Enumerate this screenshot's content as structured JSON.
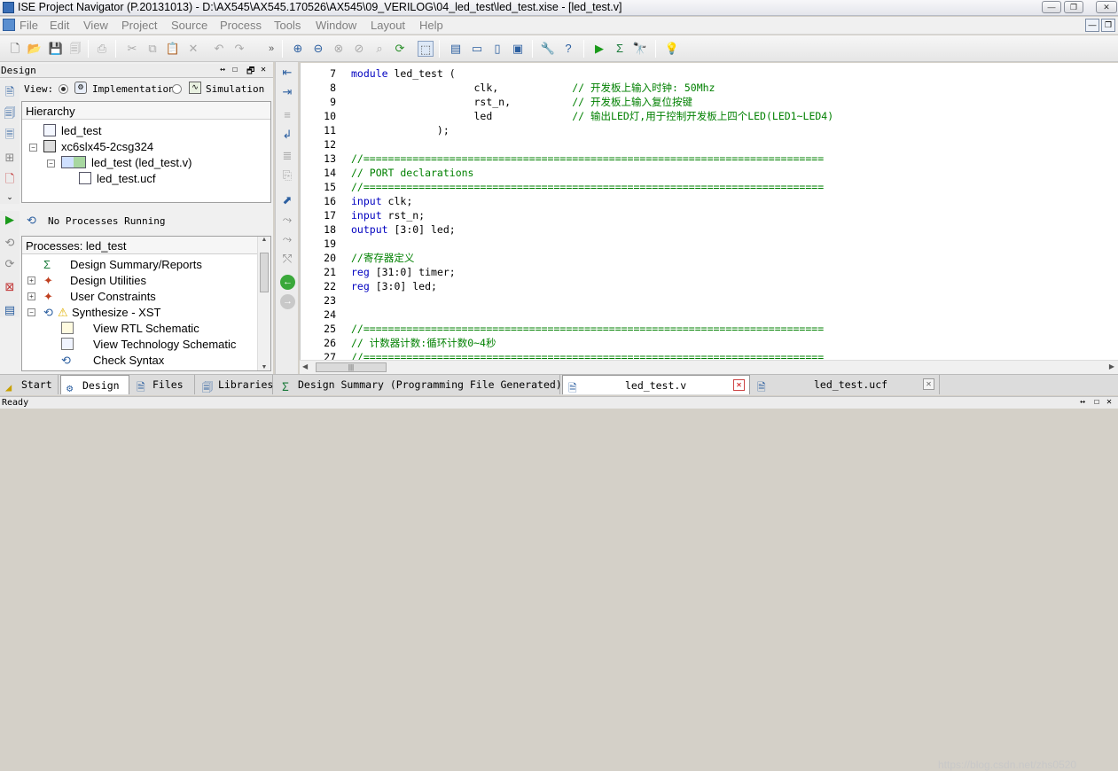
{
  "window": {
    "title": "ISE Project Navigator (P.20131013) - D:\\AX545\\AX545.170526\\AX545\\09_VERILOG\\04_led_test\\led_test.xise - [led_test.v]",
    "controls": [
      "minimize",
      "restore",
      "close"
    ]
  },
  "menu": {
    "items": [
      "File",
      "Edit",
      "View",
      "Project",
      "Source",
      "Process",
      "Tools",
      "Window",
      "Layout",
      "Help"
    ]
  },
  "toolbar": {
    "icons": [
      "new-icon",
      "open-icon",
      "save-icon",
      "save-all-icon",
      "print-icon",
      "cut-icon",
      "copy-icon",
      "paste-icon",
      "delete-icon",
      "undo-icon",
      "redo-icon",
      "more-icon",
      "zoom-in-icon",
      "zoom-out-icon",
      "zoom-fit-icon",
      "zoom-box-icon",
      "find-icon",
      "refresh-icon",
      "select-icon",
      "cascade-icon",
      "tile-h-icon",
      "tile-v-icon",
      "float-icon",
      "properties-icon",
      "help-icon",
      "run-icon",
      "sum-icon",
      "probe-icon",
      "tip-icon"
    ]
  },
  "design_panel": {
    "title": "Design",
    "view_label": "View:",
    "view_options": [
      "Implementation",
      "Simulation"
    ],
    "view_selected": "Implementation",
    "hierarchy": {
      "header": "Hierarchy",
      "items": [
        {
          "label": "led_test",
          "icon": "project-icon"
        },
        {
          "label": "xc6slx45-2csg324",
          "icon": "chip-icon"
        },
        {
          "label": "led_test (led_test.v)",
          "icon": "verilog-module-icon"
        },
        {
          "label": "led_test.ucf",
          "icon": "constraints-file-icon"
        }
      ]
    },
    "process_status": "No Processes Running",
    "processes": {
      "header": "Processes: led_test",
      "items": [
        {
          "label": "Design Summary/Reports",
          "icon": "sigma-icon"
        },
        {
          "label": "Design Utilities",
          "icon": "utilities-icon"
        },
        {
          "label": "User Constraints",
          "icon": "constraints-icon"
        },
        {
          "label": "Synthesize - XST",
          "icon": "warning-icon"
        },
        {
          "label": "View RTL Schematic",
          "icon": "schematic-icon"
        },
        {
          "label": "View Technology Schematic",
          "icon": "schematic-icon"
        },
        {
          "label": "Check Syntax",
          "icon": "check-syntax-icon"
        }
      ]
    }
  },
  "bottom_tabs": {
    "left": [
      "Start",
      "Design",
      "Files",
      "Libraries"
    ],
    "left_active": "Design",
    "documents": [
      {
        "label": "Design Summary (Programming File Generated)",
        "active": false
      },
      {
        "label": "led_test.v",
        "active": true
      },
      {
        "label": "led_test.ucf",
        "active": false
      }
    ]
  },
  "editor": {
    "lines": [
      {
        "n": "7",
        "parts": [
          [
            "kw",
            "module"
          ],
          [
            "",
            " led_test ("
          ]
        ]
      },
      {
        "n": "8",
        "parts": [
          [
            "",
            "                    clk,            "
          ],
          [
            "cm",
            "// 开发板上输入时钟: 50Mhz"
          ]
        ]
      },
      {
        "n": "9",
        "parts": [
          [
            "",
            "                    rst_n,          "
          ],
          [
            "cm",
            "// 开发板上输入复位按键"
          ]
        ]
      },
      {
        "n": "10",
        "parts": [
          [
            "",
            "                    led             "
          ],
          [
            "cm",
            "// 输出LED灯,用于控制开发板上四个LED(LED1~LED4)"
          ]
        ]
      },
      {
        "n": "11",
        "parts": [
          [
            "",
            "              );"
          ]
        ]
      },
      {
        "n": "12",
        "parts": [
          [
            "",
            ""
          ]
        ]
      },
      {
        "n": "13",
        "parts": [
          [
            "cm",
            "//==========================================================================="
          ]
        ]
      },
      {
        "n": "14",
        "parts": [
          [
            "cm",
            "// PORT declarations"
          ]
        ]
      },
      {
        "n": "15",
        "parts": [
          [
            "cm",
            "//==========================================================================="
          ]
        ]
      },
      {
        "n": "16",
        "parts": [
          [
            "kw",
            "input"
          ],
          [
            "",
            " clk;"
          ]
        ]
      },
      {
        "n": "17",
        "parts": [
          [
            "kw",
            "input"
          ],
          [
            "",
            " rst_n;"
          ]
        ]
      },
      {
        "n": "18",
        "parts": [
          [
            "kw",
            "output"
          ],
          [
            "",
            " [3:0] led;"
          ]
        ]
      },
      {
        "n": "19",
        "parts": [
          [
            "",
            ""
          ]
        ]
      },
      {
        "n": "20",
        "parts": [
          [
            "cm",
            "//寄存器定义"
          ]
        ]
      },
      {
        "n": "21",
        "parts": [
          [
            "kw",
            "reg"
          ],
          [
            "",
            " [31:0] timer;"
          ]
        ]
      },
      {
        "n": "22",
        "parts": [
          [
            "kw",
            "reg"
          ],
          [
            "",
            " [3:0] led;"
          ]
        ]
      },
      {
        "n": "23",
        "parts": [
          [
            "",
            ""
          ]
        ]
      },
      {
        "n": "24",
        "parts": [
          [
            "",
            ""
          ]
        ]
      },
      {
        "n": "25",
        "parts": [
          [
            "cm",
            "//==========================================================================="
          ]
        ]
      },
      {
        "n": "26",
        "parts": [
          [
            "cm",
            "// 计数器计数:循环计数0~4秒"
          ]
        ]
      },
      {
        "n": "27",
        "parts": [
          [
            "cm",
            "//==========================================================================="
          ]
        ]
      }
    ]
  },
  "statusbar": {
    "text": "Ready"
  },
  "watermark": "https://blog.csdn.net/zhs0520",
  "colors": {
    "keyword": "#0000c0",
    "comment": "#008000",
    "warning": "#e0b000"
  }
}
